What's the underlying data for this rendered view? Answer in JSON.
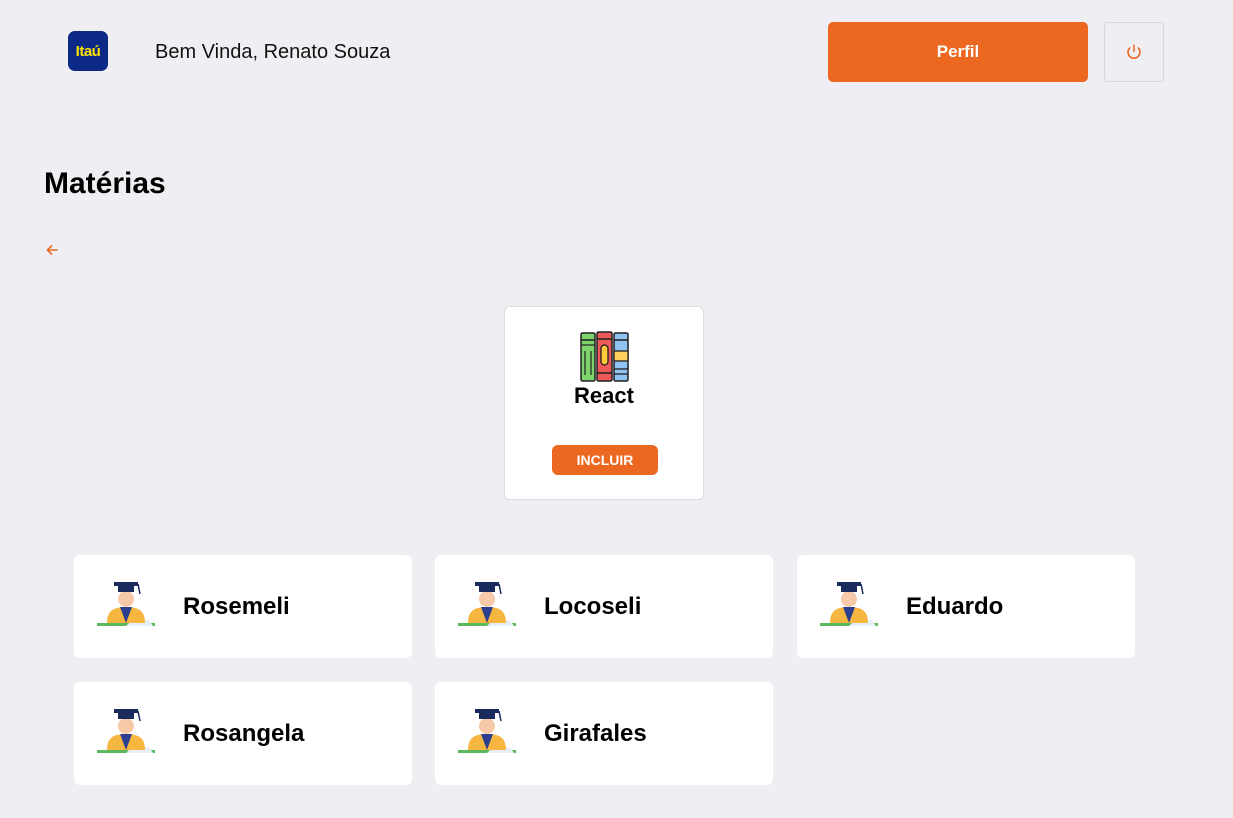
{
  "header": {
    "logo_text": "Itaú",
    "welcome": "Bem Vinda, Renato Souza",
    "profile_label": "Perfil"
  },
  "icons": {
    "power": "power-icon",
    "back": "arrow-left-icon",
    "books": "books-icon",
    "teacher": "graduate-teacher-icon"
  },
  "colors": {
    "accent": "#ec6720",
    "background": "#efeff3",
    "logo_bg": "#0c2a85",
    "logo_text": "#ffe200"
  },
  "main": {
    "title": "Matérias",
    "subject": {
      "name": "React",
      "include_label": "INCLUIR"
    },
    "teachers": [
      {
        "name": "Rosemeli"
      },
      {
        "name": "Locoseli"
      },
      {
        "name": "Eduardo"
      },
      {
        "name": "Rosangela"
      },
      {
        "name": "Girafales"
      }
    ]
  }
}
